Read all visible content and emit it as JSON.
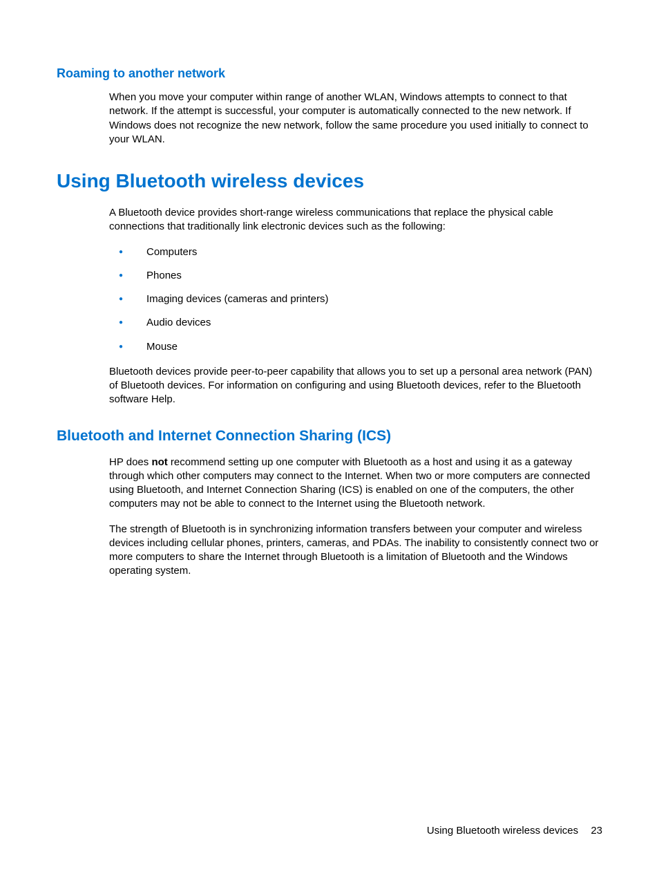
{
  "sections": {
    "roaming": {
      "heading": "Roaming to another network",
      "para1": "When you move your computer within range of another WLAN, Windows attempts to connect to that network. If the attempt is successful, your computer is automatically connected to the new network. If Windows does not recognize the new network, follow the same procedure you used initially to connect to your WLAN."
    },
    "bluetooth": {
      "heading": "Using Bluetooth wireless devices",
      "para1": "A Bluetooth device provides short-range wireless communications that replace the physical cable connections that traditionally link electronic devices such as the following:",
      "list": [
        "Computers",
        "Phones",
        "Imaging devices (cameras and printers)",
        "Audio devices",
        "Mouse"
      ],
      "para2": "Bluetooth devices provide peer-to-peer capability that allows you to set up a personal area network (PAN) of Bluetooth devices. For information on configuring and using Bluetooth devices, refer to the Bluetooth software Help."
    },
    "ics": {
      "heading": "Bluetooth and Internet Connection Sharing (ICS)",
      "para1_pre": "HP does ",
      "para1_bold": "not",
      "para1_post": " recommend setting up one computer with Bluetooth as a host and using it as a gateway through which other computers may connect to the Internet. When two or more computers are connected using Bluetooth, and Internet Connection Sharing (ICS) is enabled on one of the computers, the other computers may not be able to connect to the Internet using the Bluetooth network.",
      "para2": "The strength of Bluetooth is in synchronizing information transfers between your computer and wireless devices including cellular phones, printers, cameras, and PDAs. The inability to consistently connect two or more computers to share the Internet through Bluetooth is a limitation of Bluetooth and the Windows operating system."
    }
  },
  "footer": {
    "text": "Using Bluetooth wireless devices",
    "page": "23"
  }
}
